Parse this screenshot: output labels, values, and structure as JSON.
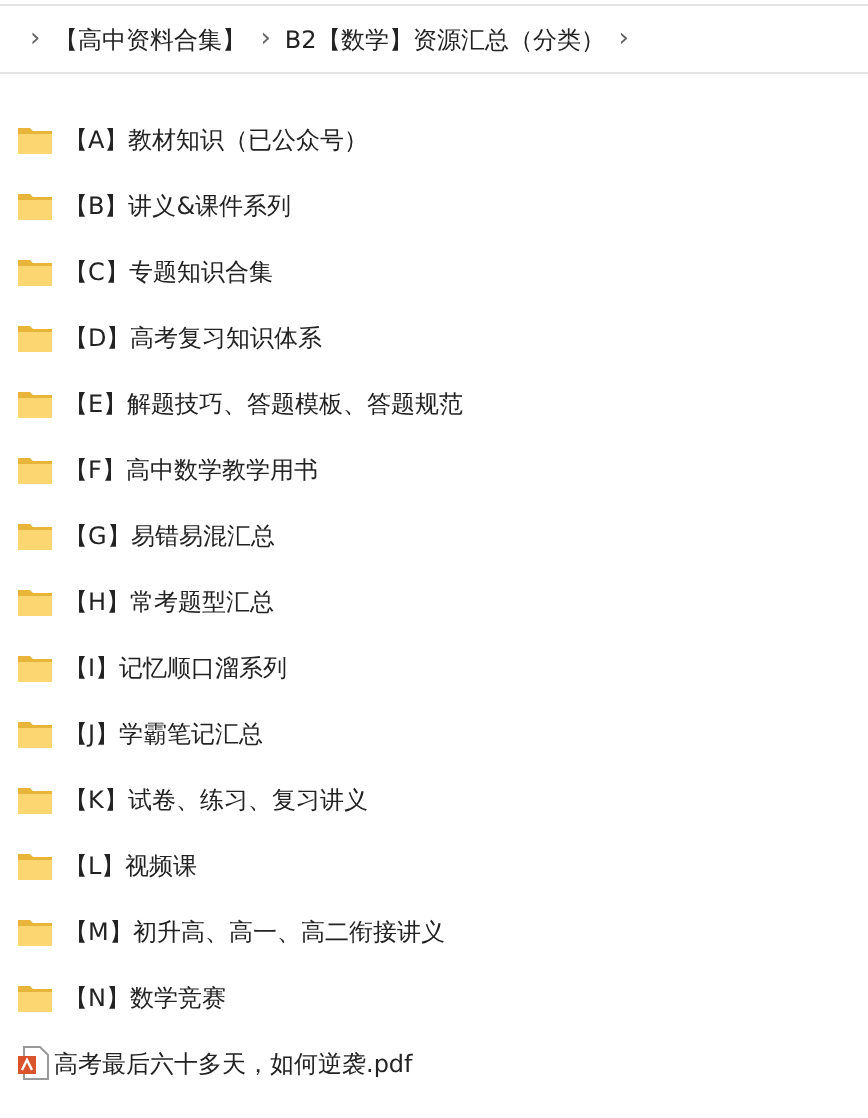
{
  "breadcrumb": [
    {
      "separator": "›",
      "label": "【高中资料合集】"
    },
    {
      "separator": "›",
      "label": "B2【数学】资源汇总（分类）"
    },
    {
      "separator": "›"
    }
  ],
  "items": [
    {
      "kind": "folder",
      "name": "【A】教材知识（已公众号）"
    },
    {
      "kind": "folder",
      "name": "【B】讲义&课件系列"
    },
    {
      "kind": "folder",
      "name": "【C】专题知识合集"
    },
    {
      "kind": "folder",
      "name": "【D】高考复习知识体系"
    },
    {
      "kind": "folder",
      "name": "【E】解题技巧、答题模板、答题规范"
    },
    {
      "kind": "folder",
      "name": "【F】高中数学教学用书"
    },
    {
      "kind": "folder",
      "name": "【G】易错易混汇总"
    },
    {
      "kind": "folder",
      "name": "【H】常考题型汇总"
    },
    {
      "kind": "folder",
      "name": "【I】记忆顺口溜系列"
    },
    {
      "kind": "folder",
      "name": "【J】学霸笔记汇总"
    },
    {
      "kind": "folder",
      "name": "【K】试卷、练习、复习讲义"
    },
    {
      "kind": "folder",
      "name": "【L】视频课"
    },
    {
      "kind": "folder",
      "name": "【M】初升高、高一、高二衔接讲义"
    },
    {
      "kind": "folder",
      "name": "【N】数学竞赛"
    },
    {
      "kind": "pdf",
      "name": "高考最后六十多天，如何逆袭.pdf"
    }
  ]
}
